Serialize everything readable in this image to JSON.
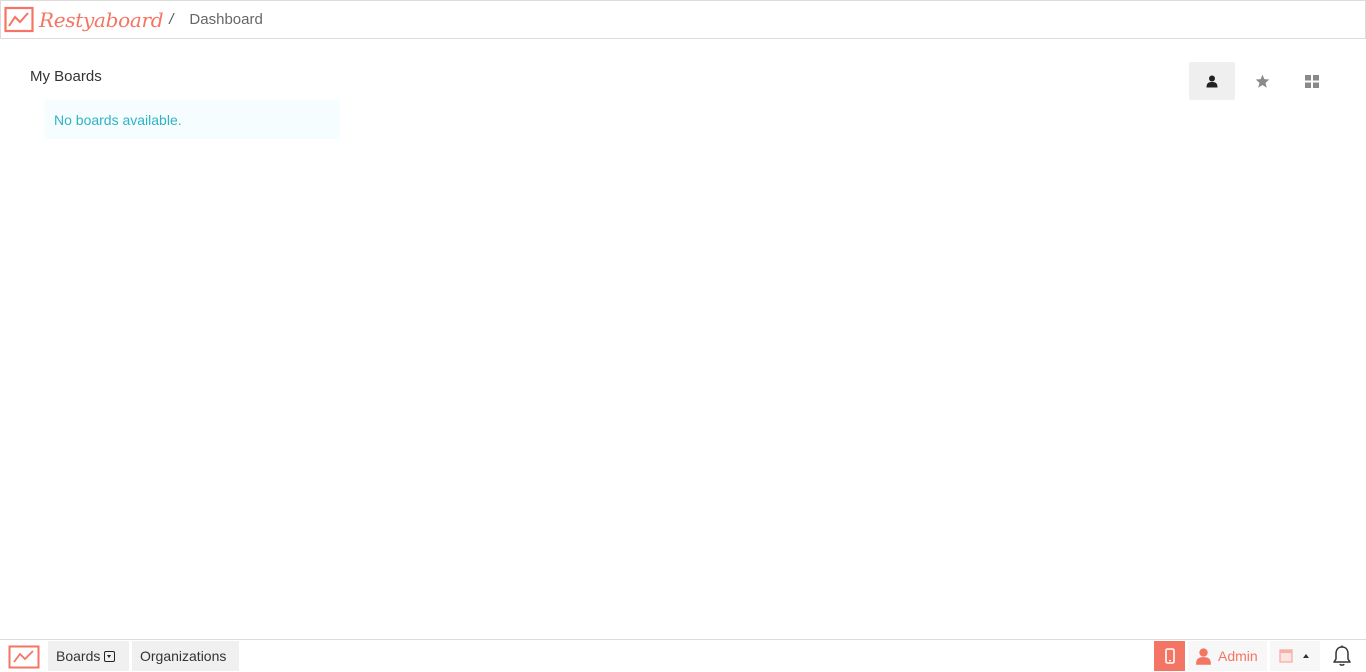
{
  "header": {
    "brand": "Restyaboard",
    "separator": "/",
    "title": "Dashboard",
    "logo_icon": "chart-line-icon"
  },
  "main": {
    "section_title": "My Boards",
    "empty_message": "No boards available.",
    "view_buttons": [
      {
        "icon": "user-icon",
        "active": true
      },
      {
        "icon": "star-icon",
        "active": false
      },
      {
        "icon": "grid-icon",
        "active": false
      }
    ]
  },
  "footer": {
    "logo_icon": "chart-line-icon",
    "boards_label": "Boards",
    "organizations_label": "Organizations",
    "admin_label": "Admin",
    "icons": [
      "mobile-icon",
      "user-icon",
      "quick-add-icon",
      "bell-icon"
    ]
  },
  "colors": {
    "brand": "#f47564",
    "info_text": "#2fb3c6",
    "info_bg": "#f5fdfe",
    "active_bg": "#efefef"
  }
}
